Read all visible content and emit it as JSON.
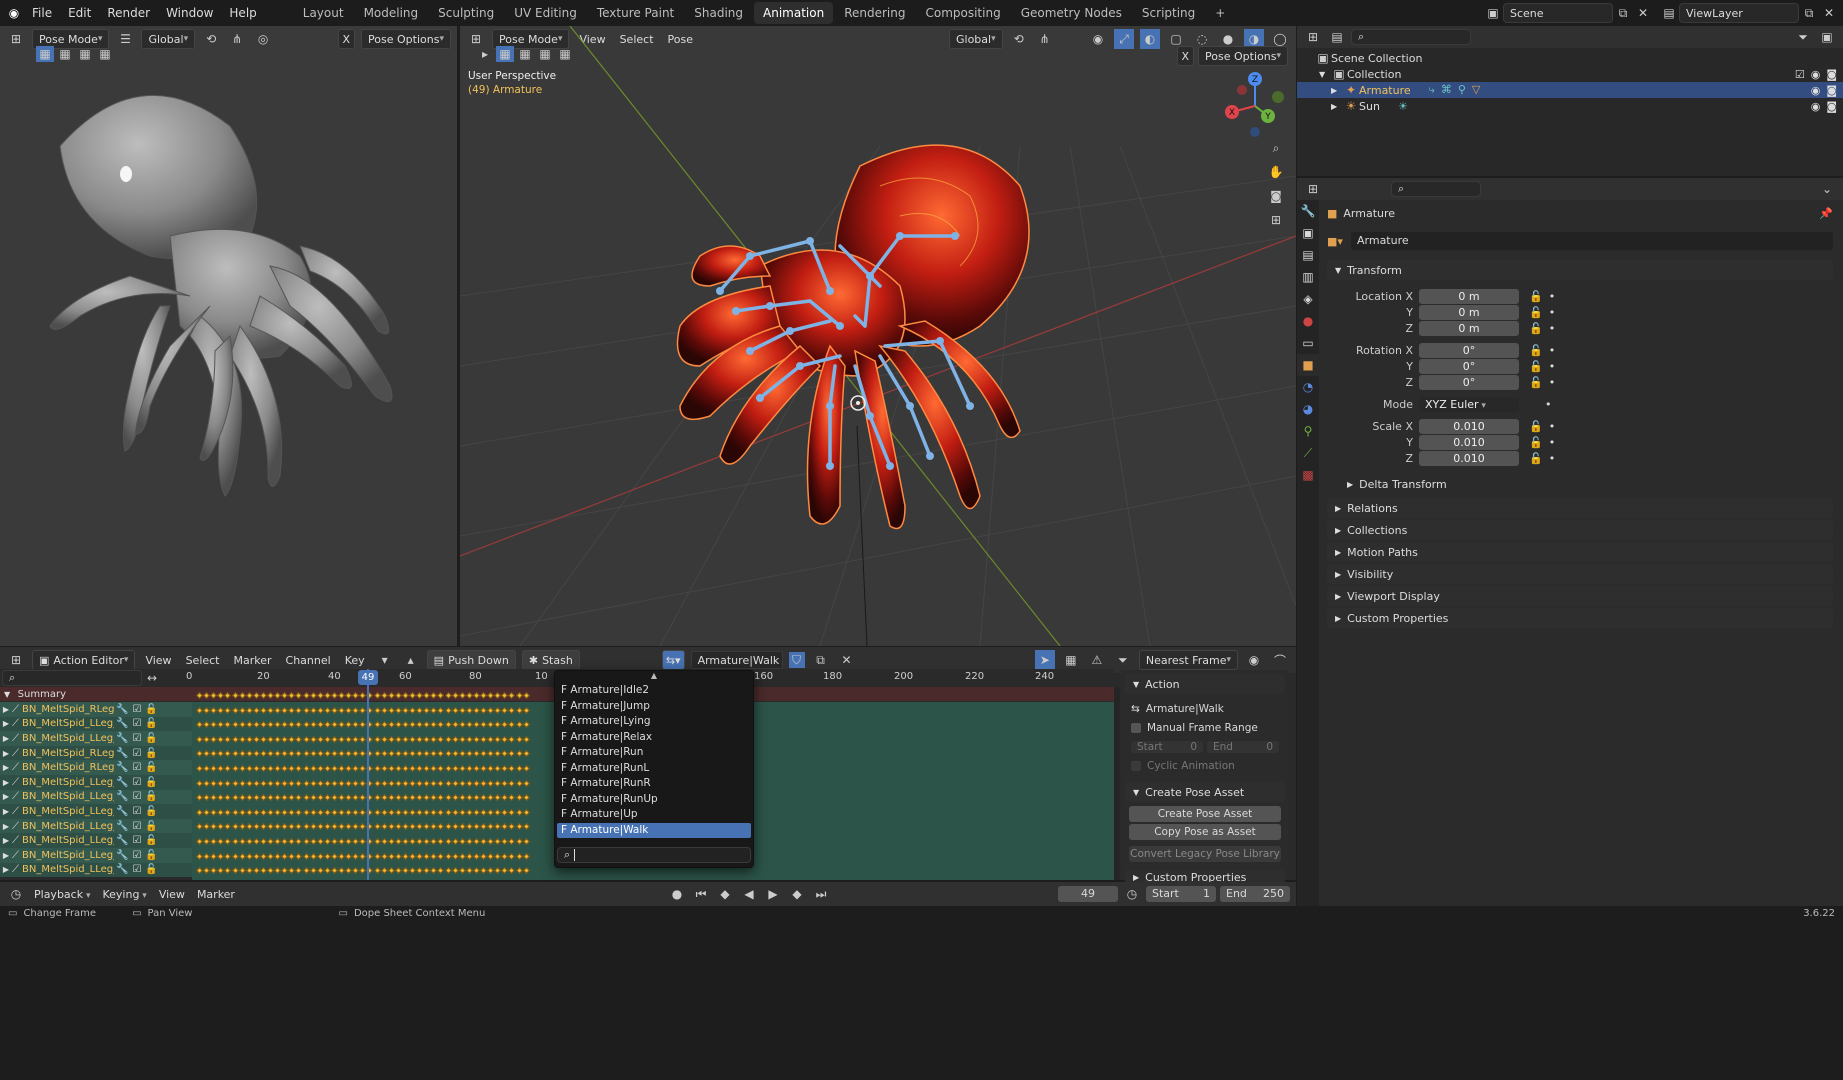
{
  "topbar": {
    "menus": [
      "File",
      "Edit",
      "Render",
      "Window",
      "Help"
    ],
    "workspaces": [
      "Layout",
      "Modeling",
      "Sculpting",
      "UV Editing",
      "Texture Paint",
      "Shading",
      "Animation",
      "Rendering",
      "Compositing",
      "Geometry Nodes",
      "Scripting"
    ],
    "active_workspace": "Animation",
    "add_tab": "+",
    "scene": "Scene",
    "view_layer": "ViewLayer"
  },
  "left_view": {
    "mode": "Pose Mode",
    "orientation": "Global",
    "pose_options": "Pose Options",
    "x_mirror": "X"
  },
  "main_view": {
    "mode": "Pose Mode",
    "menus": [
      "View",
      "Select",
      "Pose"
    ],
    "orientation": "Global",
    "pose_options": "Pose Options",
    "x_mirror": "X",
    "overlay_title": "User Perspective",
    "overlay_subtitle": "(49) Armature",
    "gizmo": {
      "z": "Z",
      "y": "Y",
      "x": "X"
    }
  },
  "outliner": {
    "root": "Scene Collection",
    "collection": "Collection",
    "items": [
      {
        "label": "Armature",
        "selected": true
      },
      {
        "label": "Sun",
        "selected": false
      }
    ]
  },
  "properties": {
    "object_name": "Armature",
    "datablock": "Armature",
    "transform": {
      "title": "Transform",
      "location_label": "Location X",
      "location": {
        "x": "0 m",
        "y": "0 m",
        "z": "0 m"
      },
      "rotation_label": "Rotation X",
      "rotation": {
        "x": "0°",
        "y": "0°",
        "z": "0°"
      },
      "mode_label": "Mode",
      "mode": "XYZ Euler",
      "scale_label": "Scale X",
      "scale": {
        "x": "0.010",
        "y": "0.010",
        "z": "0.010"
      },
      "y_label": "Y",
      "z_label": "Z",
      "delta": "Delta Transform"
    },
    "panels": [
      "Relations",
      "Collections",
      "Motion Paths",
      "Visibility",
      "Viewport Display",
      "Custom Properties"
    ]
  },
  "dope": {
    "editor": "Action Editor",
    "menus": [
      "View",
      "Select",
      "Marker",
      "Channel",
      "Key"
    ],
    "push_down": "Push Down",
    "stash": "Stash",
    "action_name": "Armature|Walk",
    "snap": "Nearest Frame",
    "current_frame": "49",
    "ruler": [
      "0",
      "20",
      "40",
      "60",
      "80",
      "10",
      "160",
      "180",
      "200",
      "220",
      "240"
    ],
    "summary": "Summary",
    "channels": [
      "BN_MeltSpid_RLeg_1_(",
      "BN_MeltSpid_LLeg_3_(",
      "BN_MeltSpid_LLeg_2_(",
      "BN_MeltSpid_RLeg_1_(",
      "BN_MeltSpid_RLeg_1_(",
      "BN_MeltSpid_LLeg_4_(",
      "BN_MeltSpid_LLeg_4_(",
      "BN_MeltSpid_LLeg_4_(",
      "BN_MeltSpid_LLeg_3_(",
      "BN_MeltSpid_LLeg_4_(",
      "BN_MeltSpid_LLeg_3_(",
      "BN_MeltSpid_LLeg_3_("
    ]
  },
  "action_popup": {
    "items": [
      "F Armature|Idle2",
      "F Armature|Jump",
      "F Armature|Lying",
      "F Armature|Relax",
      "F Armature|Run",
      "F Armature|RunL",
      "F Armature|RunR",
      "F Armature|RunUp",
      "F Armature|Up",
      "F Armature|Walk"
    ],
    "selected": "F Armature|Walk",
    "search_placeholder": ""
  },
  "action_side": {
    "action_title": "Action",
    "action_name": "Armature|Walk",
    "manual_range": "Manual Frame Range",
    "start_label": "Start",
    "start_val": "0",
    "end_label": "End",
    "end_val": "0",
    "cyclic": "Cyclic Animation",
    "pose_asset_title": "Create Pose Asset",
    "create_pose_asset": "Create Pose Asset",
    "copy_pose": "Copy Pose as Asset",
    "convert": "Convert Legacy Pose Library",
    "custom_props": "Custom Properties"
  },
  "timeline": {
    "menus": [
      "Playback",
      "Keying",
      "View",
      "Marker"
    ],
    "frame": "49",
    "start_label": "Start",
    "start": "1",
    "end_label": "End",
    "end": "250"
  },
  "status": {
    "items": [
      "Change Frame",
      "Pan View",
      "Dope Sheet Context Menu"
    ],
    "version": "3.6.22"
  },
  "colors": {
    "accent": "#4772b3",
    "keyframe": "#f0b739",
    "bone": "#7fb2e5",
    "channel_bg": "#2c5448"
  }
}
